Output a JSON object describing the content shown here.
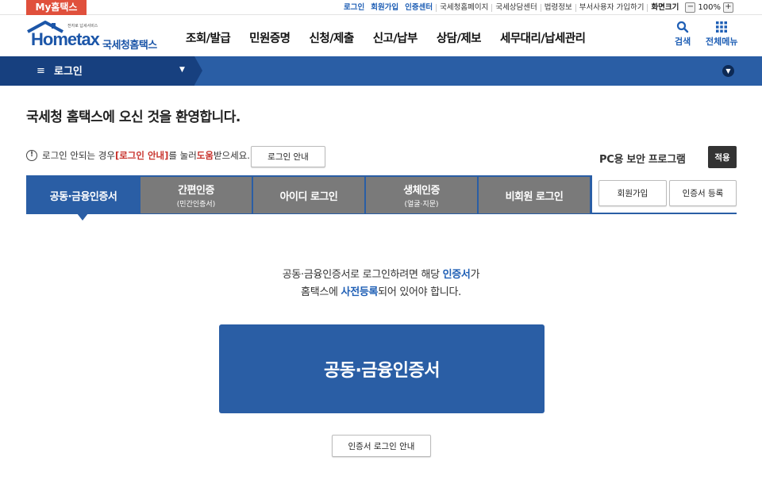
{
  "utilbar": {
    "my_tab": "My홈택스",
    "links": [
      "로그인",
      "회원가입",
      "인증센터",
      "국세청홈페이지",
      "국세상담센터",
      "법령정보",
      "부서사용자 가입하기"
    ],
    "zoom_label": "화면크기",
    "zoom_minus": "−",
    "zoom_value": "100%",
    "zoom_plus": "+"
  },
  "header": {
    "logo_home": "Hometax",
    "logo_tag": "전자로 납세서비스",
    "logo_ko": "국세청홈택스",
    "menu": [
      "조회/발급",
      "민원증명",
      "신청/제출",
      "신고/납부",
      "상담/제보",
      "세무대리/납세관리"
    ],
    "search_label": "검색",
    "allmenu_label": "전체메뉴"
  },
  "bluebar": {
    "menu_icon": "≡",
    "title": "로그인",
    "caret": "▼",
    "expand_icon": "▼"
  },
  "content": {
    "welcome": "국세청 홈택스에 오신 것을 환영합니다.",
    "notice_pre": "로그인 안되는 경우 ",
    "notice_red1": "[로그인 안내]",
    "notice_mid": "를 눌러 ",
    "notice_red2": "도움",
    "notice_post": "받으세요.",
    "guide_button": "로그인 안내",
    "pc_label": "PC용 보안 프로그램",
    "apply_button": "적용"
  },
  "tabs": [
    {
      "label": "공동·금융인증서",
      "sub": ""
    },
    {
      "label": "간편인증",
      "sub": "(민간인증서)"
    },
    {
      "label": "아이디 로그인",
      "sub": ""
    },
    {
      "label": "생체인증",
      "sub": "(얼굴·지문)"
    },
    {
      "label": "비회원 로그인",
      "sub": ""
    }
  ],
  "side_buttons": {
    "join": "회원가입",
    "cert_register": "인증서 등록"
  },
  "main": {
    "desc1_pre": "공동·금융인증서로 로그인하려면 해당 ",
    "desc1_hl": "인증서",
    "desc1_post": "가",
    "desc2_pre": "홈택스에 ",
    "desc2_hl": "사전등록",
    "desc2_post": "되어 있어야 합니다.",
    "cert_button": "공동·금융인증서",
    "cert_guide_button": "인증서 로그인 안내"
  }
}
